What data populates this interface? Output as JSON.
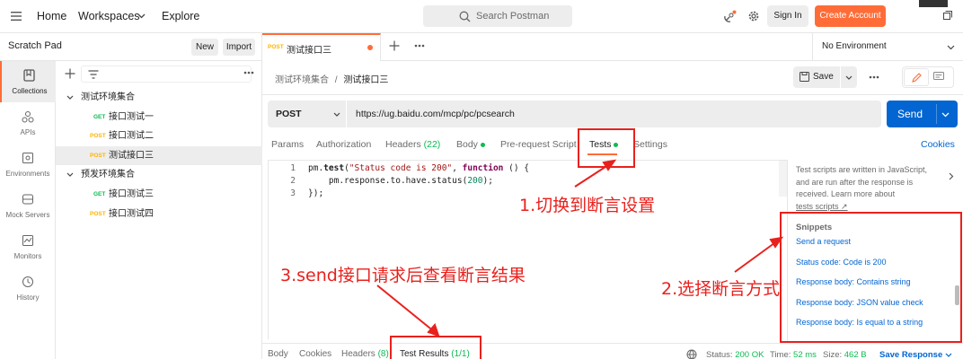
{
  "topbar": {
    "home": "Home",
    "workspaces": "Workspaces",
    "explore": "Explore",
    "search_placeholder": "Search Postman",
    "sign_in": "Sign In",
    "create_account": "Create Account"
  },
  "sidebar": {
    "title": "Scratch Pad",
    "new_label": "New",
    "import_label": "Import",
    "nav": [
      {
        "label": "Collections",
        "icon": "collections-icon"
      },
      {
        "label": "APIs",
        "icon": "apis-icon"
      },
      {
        "label": "Environments",
        "icon": "environments-icon"
      },
      {
        "label": "Mock Servers",
        "icon": "mock-servers-icon"
      },
      {
        "label": "Monitors",
        "icon": "monitors-icon"
      },
      {
        "label": "History",
        "icon": "history-icon"
      }
    ],
    "tree": [
      {
        "type": "folder",
        "label": "测试环境集合"
      },
      {
        "type": "request",
        "method": "GET",
        "label": "接口测试一"
      },
      {
        "type": "request",
        "method": "POST",
        "label": "接口测试二"
      },
      {
        "type": "request",
        "method": "POST",
        "label": "测试接口三",
        "selected": true
      },
      {
        "type": "folder",
        "label": "预发环境集合"
      },
      {
        "type": "request",
        "method": "GET",
        "label": "接口测试三"
      },
      {
        "type": "request",
        "method": "POST",
        "label": "接口测试四"
      }
    ]
  },
  "tab": {
    "method": "POST",
    "name": "测试接口三"
  },
  "environment": "No Environment",
  "breadcrumb": {
    "collection": "测试环境集合",
    "separator": "/",
    "request": "测试接口三"
  },
  "save_label": "Save",
  "request": {
    "method": "POST",
    "url": "https://ug.baidu.com/mcp/pc/pcsearch",
    "send_label": "Send"
  },
  "request_tabs": {
    "params": "Params",
    "authorization": "Authorization",
    "headers": "Headers",
    "headers_count": "(22)",
    "body": "Body",
    "pre_request": "Pre-request Script",
    "tests": "Tests",
    "settings": "Settings",
    "cookies": "Cookies"
  },
  "editor": {
    "line_numbers": [
      "1",
      "2",
      "3"
    ],
    "line1": {
      "a": "pm.",
      "b": "test",
      "c": "(",
      "d": "\"Status code is 200\"",
      "e": ", ",
      "f": "function",
      "g": " () {"
    },
    "line2": {
      "a": "    pm.response.to.have.status(",
      "b": "200",
      "c": ");"
    },
    "line3": "});"
  },
  "help": {
    "text": "Test scripts are written in JavaScript, and are run after the response is received. Learn more about",
    "link": "tests scripts ↗"
  },
  "snippets": {
    "title": "Snippets",
    "items": [
      "Send a request",
      "Status code: Code is 200",
      "Response body: Contains string",
      "Response body: JSON value check",
      "Response body: Is equal to a string"
    ]
  },
  "response_tabs": {
    "body": "Body",
    "cookies": "Cookies",
    "headers": "Headers",
    "headers_count": "(8)",
    "test_results": "Test Results",
    "test_results_count": "(1/1)"
  },
  "status": {
    "status_label": "Status:",
    "status_value": "200 OK",
    "time_label": "Time:",
    "time_value": "52 ms",
    "size_label": "Size:",
    "size_value": "462 B",
    "save_response": "Save Response"
  },
  "annotations": {
    "step1": "1.切换到断言设置",
    "step2": "2.选择断言方式",
    "step3": "3.send接口请求后查看断言结果"
  },
  "colors": {
    "accent": "#ff6c37",
    "primary": "#0265d2",
    "annotation": "#e8211d",
    "get": "#0cbb52",
    "post": "#ffb400"
  }
}
